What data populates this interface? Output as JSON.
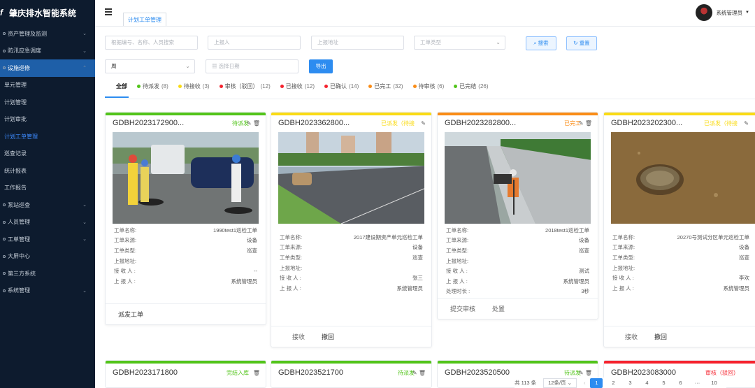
{
  "app": {
    "title": "肇庆排水智能系统",
    "logo": "f"
  },
  "sidebar": {
    "items": [
      {
        "label": "资产管理及监测",
        "type": "group"
      },
      {
        "label": "防汛应急调度",
        "type": "group"
      },
      {
        "label": "设施巡修",
        "type": "group-open"
      },
      {
        "label": "单元管理",
        "type": "sub"
      },
      {
        "label": "计划管理",
        "type": "sub"
      },
      {
        "label": "计划审批",
        "type": "sub"
      },
      {
        "label": "计划工单管理",
        "type": "sub-current"
      },
      {
        "label": "巡查记录",
        "type": "sub"
      },
      {
        "label": "统计报表",
        "type": "sub"
      },
      {
        "label": "工作报告",
        "type": "sub"
      },
      {
        "label": "泵站巡查",
        "type": "group"
      },
      {
        "label": "人员管理",
        "type": "group"
      },
      {
        "label": "工单管理",
        "type": "group"
      },
      {
        "label": "大屏中心",
        "type": "plain"
      },
      {
        "label": "第三方系统",
        "type": "plain"
      },
      {
        "label": "系统管理",
        "type": "group"
      }
    ]
  },
  "topbar": {
    "tab_label": "计划工单管理",
    "user_name": "系统管理员"
  },
  "filters": {
    "keyword_placeholder": "根据编号、名称、人员搜索",
    "reporter_placeholder": "上报人",
    "address_placeholder": "上报地址",
    "type_placeholder": "工单类型",
    "search_label": "搜索",
    "reset_label": "重置",
    "period_value": "周",
    "date_placeholder": "选择日期",
    "export_label": "导出"
  },
  "status_tabs": [
    {
      "label": "全部",
      "count": "",
      "color": ""
    },
    {
      "label": "待派发",
      "count": "(8)",
      "color": "#52c41a"
    },
    {
      "label": "待接收",
      "count": "(3)",
      "color": "#fadb14"
    },
    {
      "label": "审核（驳回）",
      "count": "(12)",
      "color": "#f5222d"
    },
    {
      "label": "已接收",
      "count": "(12)",
      "color": "#f5222d"
    },
    {
      "label": "已确认",
      "count": "(14)",
      "color": "#f5222d"
    },
    {
      "label": "已完工",
      "count": "(32)",
      "color": "#fa8c16"
    },
    {
      "label": "待审核",
      "count": "(6)",
      "color": "#fa8c16"
    },
    {
      "label": "已完结",
      "count": "(26)",
      "color": "#52c41a"
    }
  ],
  "labels": {
    "name": "工单名称:",
    "source": "工单来源:",
    "type": "工单类型:",
    "address": "上报地址:",
    "receiver": "接 收 人 :",
    "reporter": "上 报 人 :",
    "duration": "处理时长 :"
  },
  "cards": [
    {
      "code": "GDBH2023172900...",
      "status": "待派发",
      "status_color": "#52c41a",
      "bar_color": "#52c41a",
      "name": "1990test1巡检工单",
      "source": "设备",
      "type": "巡查",
      "address": "",
      "receiver": "--",
      "reporter": "系统管理员",
      "actions": [
        "派发工单"
      ]
    },
    {
      "code": "GDBH2023362800...",
      "status": "已派发（待接",
      "status_color": "#fadb14",
      "bar_color": "#fadb14",
      "name": "2017建设期资产单元巡检工单",
      "source": "设备",
      "type": "巡查",
      "address": "",
      "receiver": "张三",
      "reporter": "系统管理员",
      "actions": [
        "接收",
        "撤回"
      ]
    },
    {
      "code": "GDBH2023282800...",
      "status": "已完工",
      "status_color": "#fa8c16",
      "bar_color": "#fa8c16",
      "name": "2018test1巡检工单",
      "source": "设备",
      "type": "巡查",
      "address": "",
      "receiver": "测试",
      "reporter": "系统管理员",
      "duration": "3秒",
      "actions": [
        "提交审核",
        "处置"
      ]
    },
    {
      "code": "GDBH2023202300...",
      "status": "已派发（待接",
      "status_color": "#fadb14",
      "bar_color": "#fadb14",
      "name": "20270号测试分区单元巡检工单",
      "source": "设备",
      "type": "巡查",
      "address": "",
      "receiver": "李欢",
      "reporter": "系统管理员",
      "actions": [
        "接收",
        "撤回"
      ]
    }
  ],
  "mini_cards": [
    {
      "code": "GDBH2023171800",
      "status": "完结入库",
      "status_color": "#52c41a",
      "bar_color": "#52c41a"
    },
    {
      "code": "GDBH2023521700",
      "status": "待派发",
      "status_color": "#52c41a",
      "bar_color": "#52c41a"
    },
    {
      "code": "GDBH2023520500",
      "status": "待派发",
      "status_color": "#52c41a",
      "bar_color": "#52c41a"
    },
    {
      "code": "GDBH2023083000",
      "status": "审核（驳回）",
      "status_color": "#f5222d",
      "bar_color": "#f5222d"
    }
  ],
  "pagination": {
    "total": "共 113 条",
    "page_size": "12条/页",
    "pages": [
      "1",
      "2",
      "3",
      "4",
      "5",
      "6",
      "···",
      "10"
    ],
    "current": "1"
  }
}
